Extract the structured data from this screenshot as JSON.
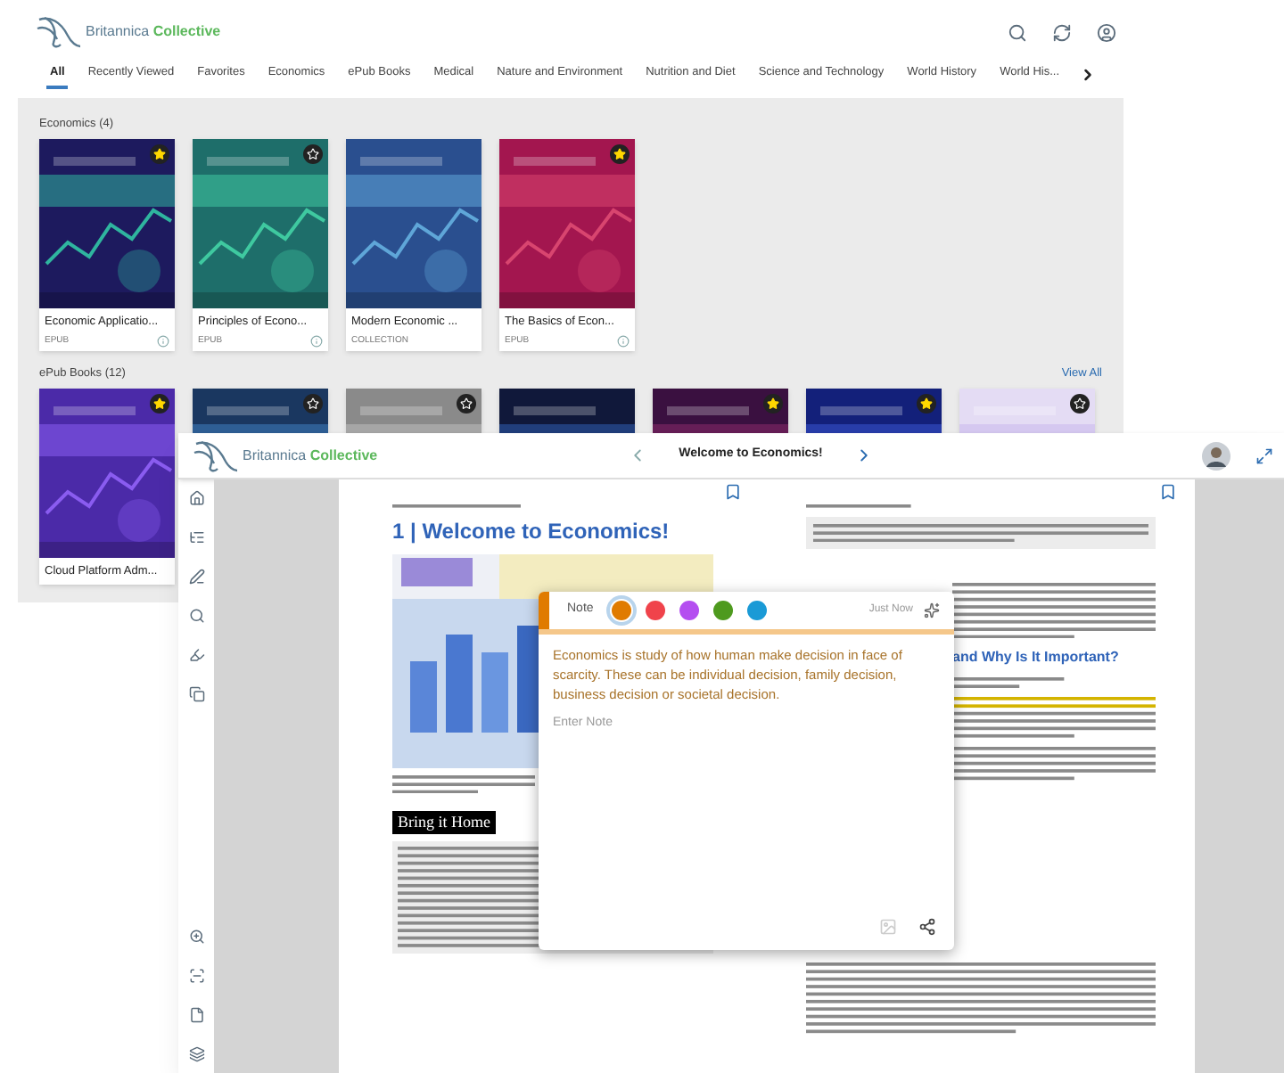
{
  "library": {
    "logo": {
      "brand": "Britannica",
      "accent": "Collective"
    },
    "tabs": [
      {
        "label": "All",
        "selected": true
      },
      {
        "label": "Recently Viewed",
        "selected": false
      },
      {
        "label": "Favorites",
        "selected": false
      },
      {
        "label": "Economics",
        "selected": false
      },
      {
        "label": "ePub Books",
        "selected": false
      },
      {
        "label": "Medical",
        "selected": false
      },
      {
        "label": "Nature and Environment",
        "selected": false
      },
      {
        "label": "Nutrition and Diet",
        "selected": false
      },
      {
        "label": "Science and Technology",
        "selected": false
      },
      {
        "label": "World History",
        "selected": false
      },
      {
        "label": "World His...",
        "selected": false
      }
    ],
    "sections": [
      {
        "title": "Economics (4)",
        "books": [
          {
            "title": "Economic Applicatio...",
            "format": "EPUB",
            "badge": true,
            "favorite": true
          },
          {
            "title": "Principles of Econo...",
            "format": "EPUB",
            "badge": true,
            "favorite": false
          },
          {
            "title": "Modern Economic ...",
            "format": "COLLECTION",
            "badge": false
          },
          {
            "title": "The Basics of Econ...",
            "format": "EPUB",
            "badge": true,
            "favorite": true
          }
        ]
      },
      {
        "title": "ePub Books (12)",
        "action": "View All",
        "books": [
          {
            "title": "Cloud Platform Adm...",
            "badge": true,
            "favorite": true
          },
          {
            "badge": true,
            "favorite": false
          },
          {
            "badge": true,
            "favorite": false
          },
          {
            "badge": false
          },
          {
            "badge": true,
            "favorite": true
          },
          {
            "badge": true,
            "favorite": true
          },
          {
            "badge": true,
            "favorite": false
          }
        ]
      }
    ]
  },
  "reader": {
    "logo": {
      "brand": "Britannica",
      "accent": "Collective"
    },
    "title": "Welcome to Economics!",
    "left_page": {
      "heading": "1 | Welcome to Economics!",
      "banner": "Bring it Home"
    },
    "right_page": {
      "heading": "and Why Is It Important?"
    },
    "note": {
      "label": "Note",
      "colors": [
        {
          "color": "#e07b00",
          "selected": true
        },
        {
          "color": "#f0434b",
          "selected": false
        },
        {
          "color": "#b44ef0",
          "selected": false
        },
        {
          "color": "#4e9a1e",
          "selected": false
        },
        {
          "color": "#1a9ad6",
          "selected": false
        }
      ],
      "time": "Just Now",
      "quote": "Economics is study of how human make decision in face of scarcity. These can be individual decision, family decision, business decision or societal decision.",
      "input": {
        "placeholder": "Enter Note"
      }
    }
  }
}
